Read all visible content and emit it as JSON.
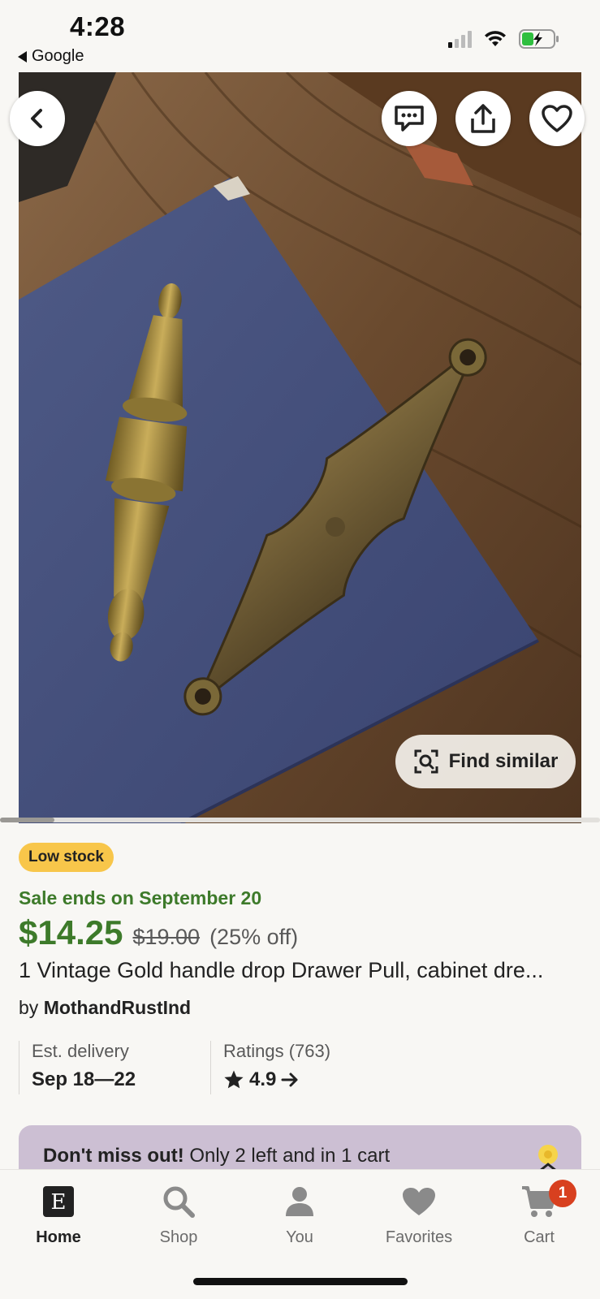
{
  "status_bar": {
    "time": "4:28",
    "back_app_label": "Google",
    "signal_icon": "cellular-signal-icon",
    "wifi_icon": "wifi-icon",
    "battery_icon": "battery-charging-icon"
  },
  "product_gallery": {
    "image_description_icon": "product-photo",
    "find_similar_label": "Find similar",
    "buttons": [
      "back-icon",
      "message-icon",
      "share-icon",
      "heart-icon"
    ],
    "image_index": 1
  },
  "listing": {
    "stock_badge": "Low stock",
    "sale_ends": "Sale ends on September 20",
    "price": "$14.25",
    "original_price": "$19.00",
    "discount": "(25% off)",
    "title": "1 Vintage Gold handle drop Drawer Pull, cabinet dre...",
    "seller_prefix": "by",
    "seller_name": "MothandRustInd",
    "delivery_label": "Est. delivery",
    "delivery_value": "Sep 18—22",
    "ratings_label": "Ratings (763)",
    "rating_value": "4.9"
  },
  "promo": {
    "bold": "Don't miss out!",
    "text": " Only 2 left and in 1 cart"
  },
  "tab_bar": {
    "items": [
      {
        "label": "Home",
        "icon": "etsy-logo-icon",
        "active": true
      },
      {
        "label": "Shop",
        "icon": "search-icon",
        "active": false
      },
      {
        "label": "You",
        "icon": "person-icon",
        "active": false
      },
      {
        "label": "Favorites",
        "icon": "heart-icon",
        "active": false
      },
      {
        "label": "Cart",
        "icon": "cart-icon",
        "active": false
      }
    ],
    "cart_count": "1"
  },
  "colors": {
    "sale_green": "#3d7a2a",
    "badge_yellow": "#f8c64a",
    "promo_purple": "#ccbfd3",
    "cart_badge_red": "#d8401f"
  }
}
